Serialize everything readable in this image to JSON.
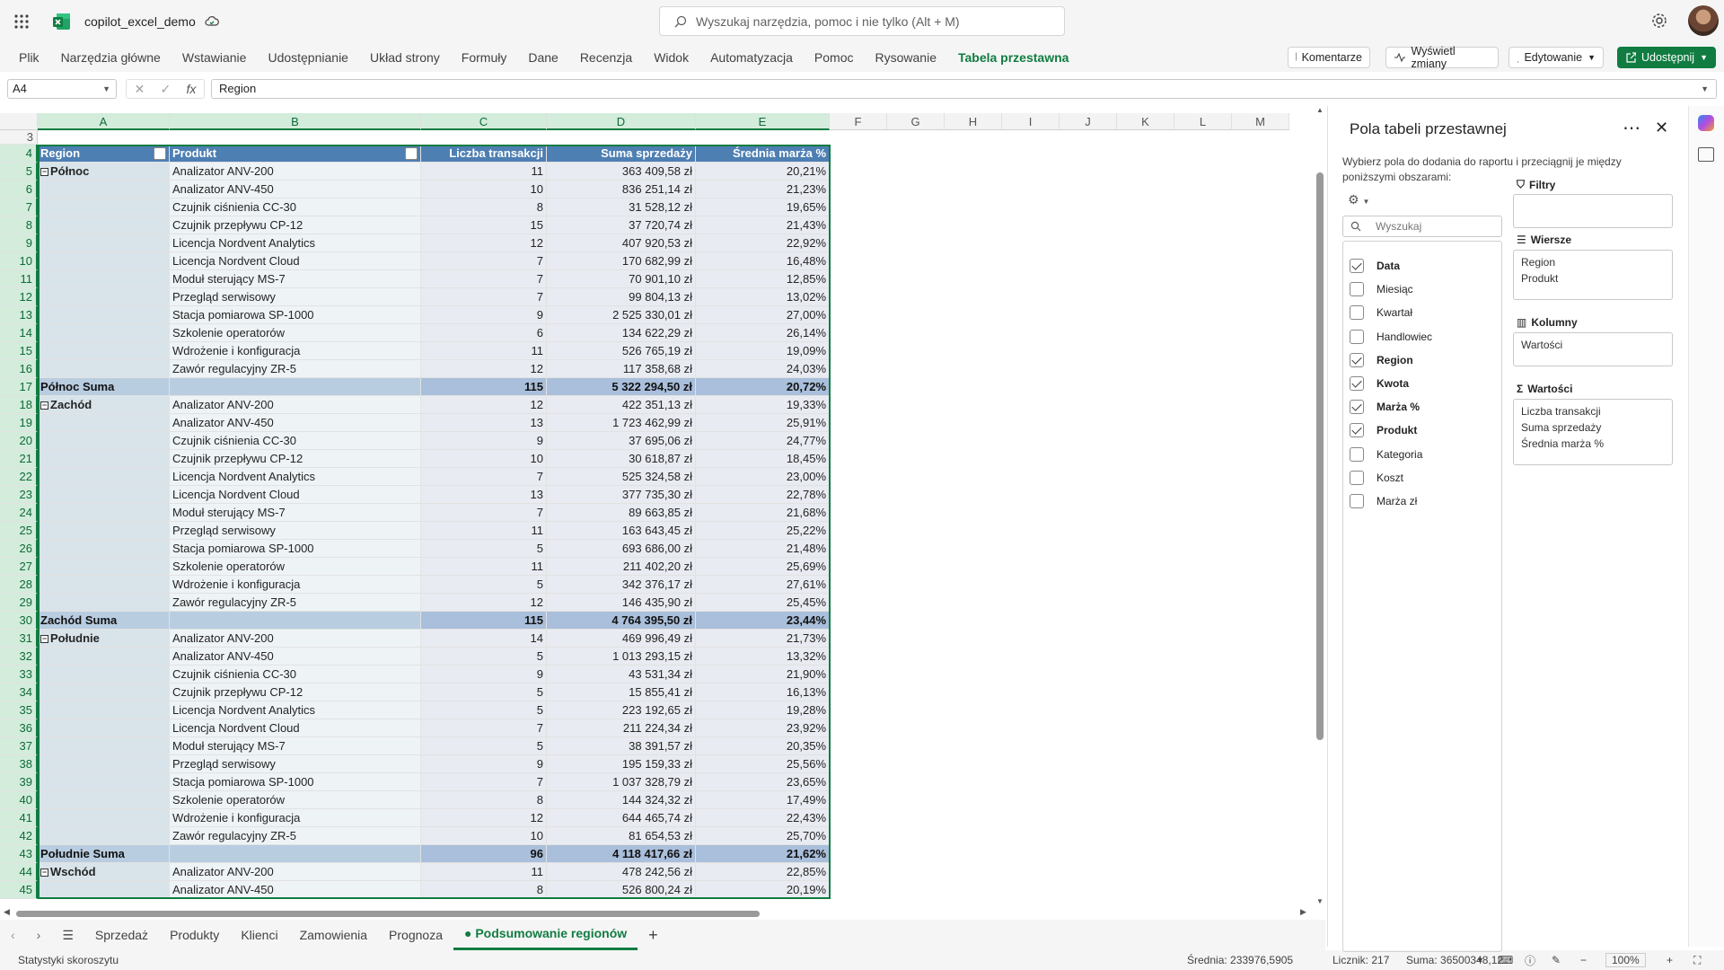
{
  "app": {
    "filename": "copilot_excel_demo"
  },
  "search": {
    "placeholder": "Wyszukaj narzędzia, pomoc i nie tylko (Alt + M)"
  },
  "menu": [
    "Plik",
    "Narzędzia główne",
    "Wstawianie",
    "Udostępnianie",
    "Układ strony",
    "Formuły",
    "Dane",
    "Recenzja",
    "Widok",
    "Automatyzacja",
    "Pomoc",
    "Rysowanie",
    "Tabela przestawna"
  ],
  "ribbon_buttons": {
    "comments": "Komentarze",
    "show_changes": "Wyświetl zmiany",
    "editing": "Edytowanie",
    "share": "Udostępnij"
  },
  "formula_bar": {
    "name_box": "A4",
    "fx": "fx",
    "content": "Region"
  },
  "columns": [
    "A",
    "B",
    "C",
    "D",
    "E",
    "F",
    "G",
    "H",
    "I",
    "J",
    "K",
    "L",
    "M"
  ],
  "header_row": {
    "num": "4",
    "a": "Region",
    "b": "Produkt",
    "c": "Liczba transakcji",
    "d": "Suma sprzedaży",
    "e": "Średnia marża %"
  },
  "rows": [
    {
      "num": "5",
      "a": "Północ",
      "b": "Analizator ANV-200",
      "c": "11",
      "d": "363 409,58 zł",
      "e": "20,21%",
      "group": true
    },
    {
      "num": "6",
      "a": "",
      "b": "Analizator ANV-450",
      "c": "10",
      "d": "836 251,14 zł",
      "e": "21,23%"
    },
    {
      "num": "7",
      "a": "",
      "b": "Czujnik ciśnienia CC-30",
      "c": "8",
      "d": "31 528,12 zł",
      "e": "19,65%"
    },
    {
      "num": "8",
      "a": "",
      "b": "Czujnik przepływu CP-12",
      "c": "15",
      "d": "37 720,74 zł",
      "e": "21,43%"
    },
    {
      "num": "9",
      "a": "",
      "b": "Licencja Nordvent Analytics",
      "c": "12",
      "d": "407 920,53 zł",
      "e": "22,92%"
    },
    {
      "num": "10",
      "a": "",
      "b": "Licencja Nordvent Cloud",
      "c": "7",
      "d": "170 682,99 zł",
      "e": "16,48%"
    },
    {
      "num": "11",
      "a": "",
      "b": "Moduł sterujący MS-7",
      "c": "7",
      "d": "70 901,10 zł",
      "e": "12,85%"
    },
    {
      "num": "12",
      "a": "",
      "b": "Przegląd serwisowy",
      "c": "7",
      "d": "99 804,13 zł",
      "e": "13,02%"
    },
    {
      "num": "13",
      "a": "",
      "b": "Stacja pomiarowa SP-1000",
      "c": "9",
      "d": "2 525 330,01 zł",
      "e": "27,00%"
    },
    {
      "num": "14",
      "a": "",
      "b": "Szkolenie operatorów",
      "c": "6",
      "d": "134 622,29 zł",
      "e": "26,14%"
    },
    {
      "num": "15",
      "a": "",
      "b": "Wdrożenie i konfiguracja",
      "c": "11",
      "d": "526 765,19 zł",
      "e": "19,09%"
    },
    {
      "num": "16",
      "a": "",
      "b": "Zawór regulacyjny ZR-5",
      "c": "12",
      "d": "117 358,68 zł",
      "e": "24,03%"
    },
    {
      "num": "17",
      "a": "Północ Suma",
      "b": "",
      "c": "115",
      "d": "5 322 294,50 zł",
      "e": "20,72%",
      "sum": true
    },
    {
      "num": "18",
      "a": "Zachód",
      "b": "Analizator ANV-200",
      "c": "12",
      "d": "422 351,13 zł",
      "e": "19,33%",
      "group": true
    },
    {
      "num": "19",
      "a": "",
      "b": "Analizator ANV-450",
      "c": "13",
      "d": "1 723 462,99 zł",
      "e": "25,91%"
    },
    {
      "num": "20",
      "a": "",
      "b": "Czujnik ciśnienia CC-30",
      "c": "9",
      "d": "37 695,06 zł",
      "e": "24,77%"
    },
    {
      "num": "21",
      "a": "",
      "b": "Czujnik przepływu CP-12",
      "c": "10",
      "d": "30 618,87 zł",
      "e": "18,45%"
    },
    {
      "num": "22",
      "a": "",
      "b": "Licencja Nordvent Analytics",
      "c": "7",
      "d": "525 324,58 zł",
      "e": "23,00%"
    },
    {
      "num": "23",
      "a": "",
      "b": "Licencja Nordvent Cloud",
      "c": "13",
      "d": "377 735,30 zł",
      "e": "22,78%"
    },
    {
      "num": "24",
      "a": "",
      "b": "Moduł sterujący MS-7",
      "c": "7",
      "d": "89 663,85 zł",
      "e": "21,68%"
    },
    {
      "num": "25",
      "a": "",
      "b": "Przegląd serwisowy",
      "c": "11",
      "d": "163 643,45 zł",
      "e": "25,22%"
    },
    {
      "num": "26",
      "a": "",
      "b": "Stacja pomiarowa SP-1000",
      "c": "5",
      "d": "693 686,00 zł",
      "e": "21,48%"
    },
    {
      "num": "27",
      "a": "",
      "b": "Szkolenie operatorów",
      "c": "11",
      "d": "211 402,20 zł",
      "e": "25,69%"
    },
    {
      "num": "28",
      "a": "",
      "b": "Wdrożenie i konfiguracja",
      "c": "5",
      "d": "342 376,17 zł",
      "e": "27,61%"
    },
    {
      "num": "29",
      "a": "",
      "b": "Zawór regulacyjny ZR-5",
      "c": "12",
      "d": "146 435,90 zł",
      "e": "25,45%"
    },
    {
      "num": "30",
      "a": "Zachód Suma",
      "b": "",
      "c": "115",
      "d": "4 764 395,50 zł",
      "e": "23,44%",
      "sum": true
    },
    {
      "num": "31",
      "a": "Południe",
      "b": "Analizator ANV-200",
      "c": "14",
      "d": "469 996,49 zł",
      "e": "21,73%",
      "group": true
    },
    {
      "num": "32",
      "a": "",
      "b": "Analizator ANV-450",
      "c": "5",
      "d": "1 013 293,15 zł",
      "e": "13,32%"
    },
    {
      "num": "33",
      "a": "",
      "b": "Czujnik ciśnienia CC-30",
      "c": "9",
      "d": "43 531,34 zł",
      "e": "21,90%"
    },
    {
      "num": "34",
      "a": "",
      "b": "Czujnik przepływu CP-12",
      "c": "5",
      "d": "15 855,41 zł",
      "e": "16,13%"
    },
    {
      "num": "35",
      "a": "",
      "b": "Licencja Nordvent Analytics",
      "c": "5",
      "d": "223 192,65 zł",
      "e": "19,28%"
    },
    {
      "num": "36",
      "a": "",
      "b": "Licencja Nordvent Cloud",
      "c": "7",
      "d": "211 224,34 zł",
      "e": "23,92%"
    },
    {
      "num": "37",
      "a": "",
      "b": "Moduł sterujący MS-7",
      "c": "5",
      "d": "38 391,57 zł",
      "e": "20,35%"
    },
    {
      "num": "38",
      "a": "",
      "b": "Przegląd serwisowy",
      "c": "9",
      "d": "195 159,33 zł",
      "e": "25,56%"
    },
    {
      "num": "39",
      "a": "",
      "b": "Stacja pomiarowa SP-1000",
      "c": "7",
      "d": "1 037 328,79 zł",
      "e": "23,65%"
    },
    {
      "num": "40",
      "a": "",
      "b": "Szkolenie operatorów",
      "c": "8",
      "d": "144 324,32 zł",
      "e": "17,49%"
    },
    {
      "num": "41",
      "a": "",
      "b": "Wdrożenie i konfiguracja",
      "c": "12",
      "d": "644 465,74 zł",
      "e": "22,43%"
    },
    {
      "num": "42",
      "a": "",
      "b": "Zawór regulacyjny ZR-5",
      "c": "10",
      "d": "81 654,53 zł",
      "e": "25,70%"
    },
    {
      "num": "43",
      "a": "Południe Suma",
      "b": "",
      "c": "96",
      "d": "4 118 417,66 zł",
      "e": "21,62%",
      "sum": true
    },
    {
      "num": "44",
      "a": "Wschód",
      "b": "Analizator ANV-200",
      "c": "11",
      "d": "478 242,56 zł",
      "e": "22,85%",
      "group": true
    },
    {
      "num": "45",
      "a": "",
      "b": "Analizator ANV-450",
      "c": "8",
      "d": "526 800,24 zł",
      "e": "20,19%"
    }
  ],
  "sheet_tabs": [
    "Sprzedaż",
    "Produkty",
    "Klienci",
    "Zamowienia",
    "Prognoza",
    "Podsumowanie regionów"
  ],
  "active_tab": "Podsumowanie regionów",
  "status": {
    "left": "Statystyki skoroszytu",
    "avg": "Średnia: 233976,5905",
    "count": "Licznik: 217",
    "sum": "Suma: 36500348,12",
    "zoom": "100%"
  },
  "pivot_panel": {
    "title": "Pola tabeli przestawnej",
    "desc": "Wybierz pola do dodania do raportu i przeciągnij je między poniższymi obszarami:",
    "search_placeholder": "Wyszukaj",
    "fields": [
      {
        "label": "Data",
        "checked": true
      },
      {
        "label": "Miesiąc",
        "checked": false
      },
      {
        "label": "Kwartał",
        "checked": false
      },
      {
        "label": "Handlowiec",
        "checked": false
      },
      {
        "label": "Region",
        "checked": true
      },
      {
        "label": "Kwota",
        "checked": true
      },
      {
        "label": "Marża %",
        "checked": true
      },
      {
        "label": "Produkt",
        "checked": true
      },
      {
        "label": "Kategoria",
        "checked": false
      },
      {
        "label": "Koszt",
        "checked": false
      },
      {
        "label": "Marża zł",
        "checked": false
      }
    ],
    "filters_label": "Filtry",
    "rows_label": "Wiersze",
    "rows_items": [
      "Region",
      "Produkt"
    ],
    "columns_label": "Kolumny",
    "columns_items": [
      "Wartości"
    ],
    "values_label": "Wartości",
    "values_items": [
      "Liczba transakcji",
      "Suma sprzedaży",
      "Średnia marża %"
    ]
  },
  "colors": {
    "accent": "#107c41",
    "pivot_header": "#4e7fb3"
  }
}
